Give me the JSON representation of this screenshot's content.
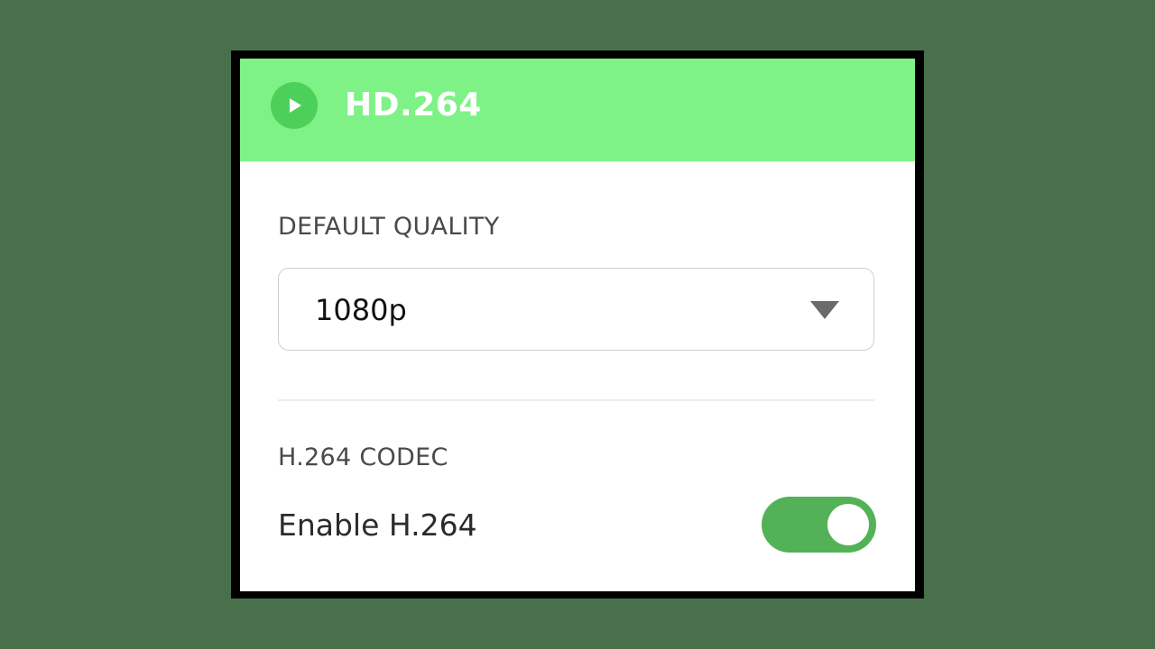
{
  "app": {
    "title": "HD.264",
    "icon": "play-icon"
  },
  "colors": {
    "header_bg": "#7ef287",
    "icon_bg": "#4dd05a",
    "toggle_on": "#53b257",
    "page_bg": "#48714b"
  },
  "quality": {
    "label": "DEFAULT QUALITY",
    "selected": "1080p",
    "icon": "chevron-down-icon"
  },
  "codec": {
    "label": "H.264 CODEC",
    "toggle_label": "Enable H.264",
    "enabled": true
  }
}
